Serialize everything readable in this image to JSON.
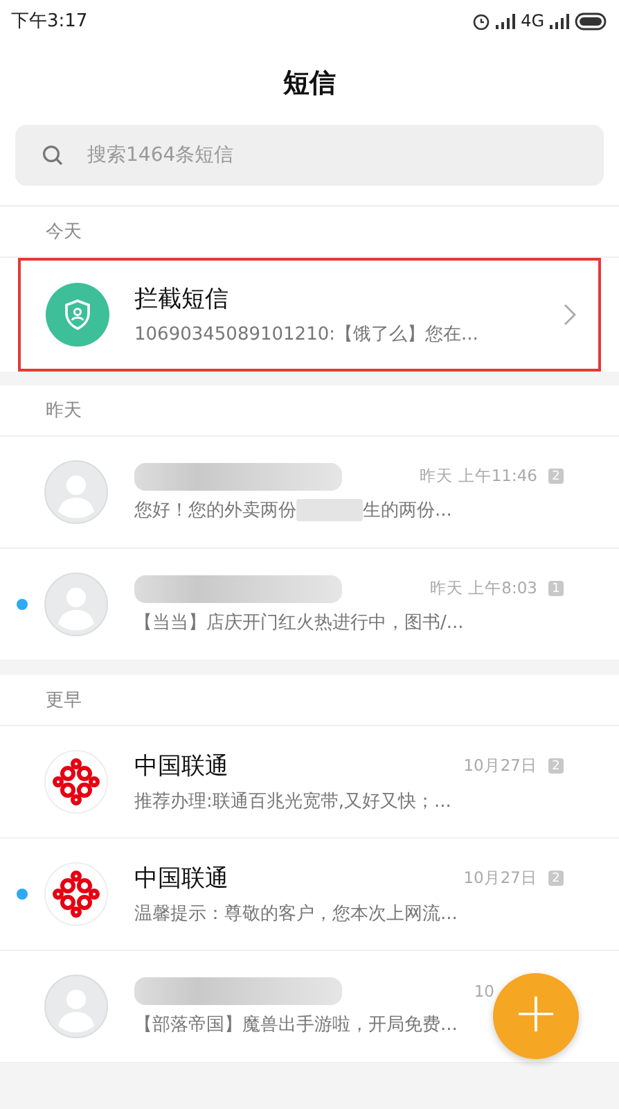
{
  "status_bar": {
    "time": "下午3:17",
    "network": "4G"
  },
  "title": "短信",
  "search": {
    "placeholder": "搜索1464条短信"
  },
  "sections": [
    {
      "header": "今天",
      "rows": [
        {
          "kind": "blocked",
          "name": "拦截短信",
          "preview": "10690345089101210:【饿了么】您在...",
          "highlighted": true
        }
      ]
    },
    {
      "header": "昨天",
      "rows": [
        {
          "kind": "person",
          "name_redacted": true,
          "time": "昨天 上午11:46",
          "sim": "2",
          "preview": "您好！您的外卖两份",
          "preview_redacted": true,
          "preview_end": "生的两份...",
          "unread": false
        },
        {
          "kind": "person",
          "name_redacted": true,
          "time": "昨天 上午8:03",
          "sim": "1",
          "preview": "【当当】店庆开门红火热进行中，图书/...",
          "unread": true
        }
      ]
    },
    {
      "header": "更早",
      "rows": [
        {
          "kind": "logo",
          "name": "中国联通",
          "time": "10月27日",
          "sim": "2",
          "preview": "推荐办理:联通百兆光宽带,又好又快；...",
          "unread": false
        },
        {
          "kind": "logo",
          "name": "中国联通",
          "time": "10月27日",
          "sim": "2",
          "preview": "温馨提示：尊敬的客户，您本次上网流...",
          "unread": true
        },
        {
          "kind": "person",
          "name_redacted": true,
          "time": "10",
          "preview": "【部落帝国】魔兽出手游啦，开局免费...",
          "unread": false
        }
      ]
    }
  ],
  "fab": {
    "label": "+"
  }
}
